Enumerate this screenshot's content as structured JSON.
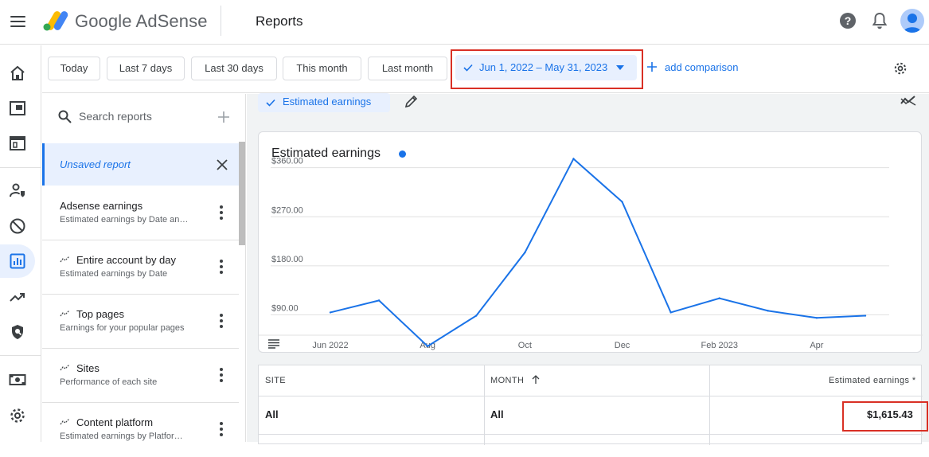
{
  "app": {
    "brand": "Google AdSense",
    "page_title": "Reports",
    "icons": {
      "menu": "hamburger-menu-icon",
      "help": "help-icon",
      "notifications": "bell-icon",
      "account": "avatar"
    }
  },
  "rail": {
    "items": [
      {
        "name": "home",
        "icon": "home-icon"
      },
      {
        "name": "ads",
        "icon": "ads-icon"
      },
      {
        "name": "sites",
        "icon": "browser-icon"
      },
      {
        "name": "privacy",
        "icon": "privacy-messaging-icon"
      },
      {
        "name": "blocking",
        "icon": "block-icon"
      },
      {
        "name": "reports",
        "icon": "reports-icon",
        "active": true
      },
      {
        "name": "optimization",
        "icon": "trending-icon"
      },
      {
        "name": "policy",
        "icon": "shield-icon"
      },
      {
        "name": "payments",
        "icon": "payments-icon"
      },
      {
        "name": "settings",
        "icon": "gear-icon"
      }
    ]
  },
  "filters": {
    "presets": [
      "Today",
      "Last 7 days",
      "Last 30 days",
      "This month",
      "Last month"
    ],
    "date_range": "Jun 1, 2022 – May 31, 2023",
    "add_comparison": "add comparison"
  },
  "reports_panel": {
    "search_placeholder": "Search reports",
    "unsaved": "Unsaved report",
    "items": [
      {
        "title": "Adsense earnings",
        "subtitle": "Estimated earnings by Date an…",
        "auto": false
      },
      {
        "title": "Entire account by day",
        "subtitle": "Estimated earnings by Date",
        "auto": true
      },
      {
        "title": "Top pages",
        "subtitle": "Earnings for your popular pages",
        "auto": true
      },
      {
        "title": "Sites",
        "subtitle": "Performance of each site",
        "auto": true
      },
      {
        "title": "Content platform",
        "subtitle": "Estimated earnings by Platfor…",
        "auto": true
      }
    ]
  },
  "main": {
    "metric_chip": "Estimated earnings",
    "chart_title": "Estimated earnings"
  },
  "chart_data": {
    "type": "line",
    "title": "Estimated earnings",
    "y_ticks": [
      "$360.00",
      "$270.00",
      "$180.00",
      "$90.00"
    ],
    "y_tick_values": [
      360,
      270,
      180,
      90
    ],
    "x_tick_labels": [
      "Jun 2022",
      "Aug",
      "Oct",
      "Dec",
      "Feb 2023",
      "Apr"
    ],
    "x_tick_indices": [
      0,
      2,
      4,
      6,
      8,
      10
    ],
    "categories": [
      "Jun 2022",
      "Jul 2022",
      "Aug 2022",
      "Sep 2022",
      "Oct 2022",
      "Nov 2022",
      "Dec 2022",
      "Jan 2023",
      "Feb 2023",
      "Mar 2023",
      "Apr 2023",
      "May 2023"
    ],
    "series": [
      {
        "values": [
          90,
          112,
          28,
          84,
          200,
          372,
          293,
          90,
          116,
          93,
          80,
          84
        ],
        "color": "#1a73e8"
      }
    ],
    "ylim": [
      0,
      380
    ],
    "grid": true
  },
  "table": {
    "headers": [
      "SITE",
      "MONTH",
      "Estimated earnings *"
    ],
    "sort_icon": "arrow-up-icon",
    "total_row": [
      "All",
      "All",
      "$1,615.43"
    ]
  },
  "colors": {
    "accent": "#1a73e8",
    "highlight": "#d93025"
  }
}
